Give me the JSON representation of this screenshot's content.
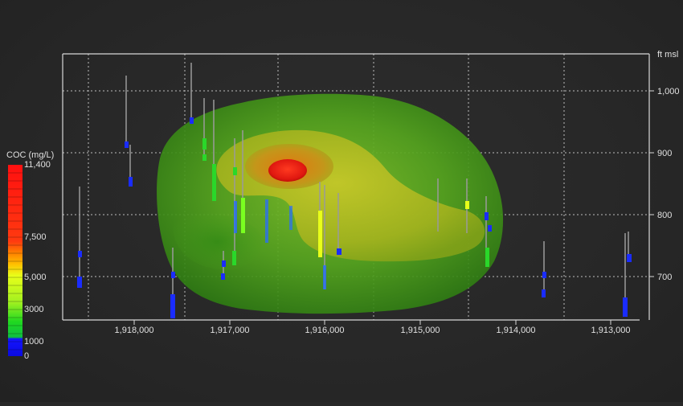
{
  "legend": {
    "title": "COC (mg/L)",
    "labels": [
      "11,400",
      "7,500",
      "5,000",
      "3000",
      "1000",
      "0"
    ],
    "colors": {
      "red": "#ff1a1a",
      "orange": "#ff8000",
      "yellow": "#e8ff1a",
      "green": "#20d820",
      "blue": "#1414ff"
    }
  },
  "axes": {
    "y_unit": "ft msl",
    "y_ticks": [
      "1,000",
      "900",
      "800",
      "700"
    ],
    "x_ticks": [
      "1,918,000",
      "1,917,000",
      "1,916,000",
      "1,915,000",
      "1,914,000",
      "1,913,000"
    ]
  },
  "colors": {
    "background": "#282828",
    "frame": "#d8d8d8",
    "grid": "#bcbcbc",
    "plume_outer": "#3c9a18",
    "plume_mid": "#b8b818",
    "plume_core": "#e02010"
  }
}
